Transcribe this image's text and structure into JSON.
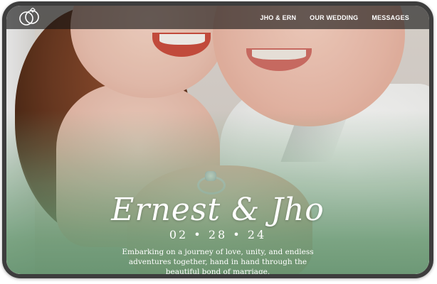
{
  "nav": {
    "logo_icon": "interlocked-rings-logo",
    "links": [
      {
        "label": "JHO & ERN"
      },
      {
        "label": "OUR WEDDING"
      },
      {
        "label": "MESSAGES"
      }
    ]
  },
  "hero": {
    "names": "Ernest & Jho",
    "date": "02 • 28 • 24",
    "tagline": "Embarking on a journey of love, unity, and endless adventures together, hand in hand through the beautiful bond of marriage."
  },
  "colors": {
    "nav_background": "#141414",
    "accent_green": "#6c9e76",
    "frame": "#3d3d3d",
    "text": "#ffffff"
  }
}
